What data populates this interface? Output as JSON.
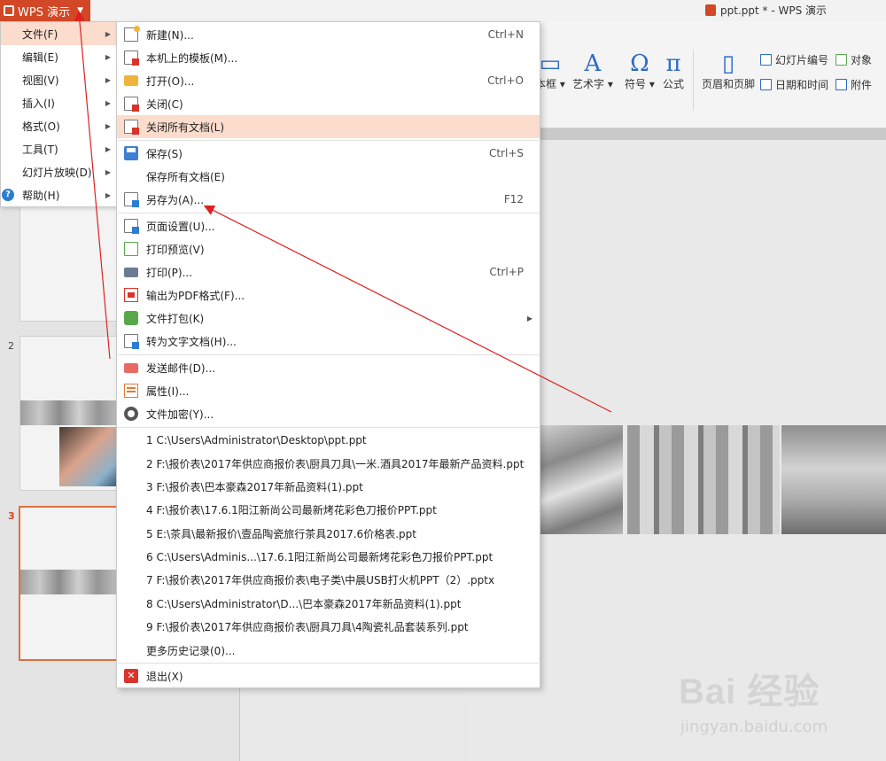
{
  "app": {
    "name": "WPS 演示",
    "window_title": "ppt.ppt * - WPS 演示"
  },
  "ribbon": {
    "items": [
      {
        "label": "本框 ▾"
      },
      {
        "label": "艺术字 ▾",
        "glyph": "A"
      },
      {
        "label": "符号 ▾",
        "glyph": "Ω"
      },
      {
        "label": "公式",
        "glyph": "π"
      },
      {
        "label": "页眉和页脚"
      },
      {
        "label": "幻灯片编号"
      },
      {
        "label": "对象"
      },
      {
        "label": "日期和时间"
      },
      {
        "label": "附件"
      }
    ]
  },
  "main_menu": {
    "items": [
      {
        "label": "文件(F)"
      },
      {
        "label": "编辑(E)"
      },
      {
        "label": "视图(V)"
      },
      {
        "label": "插入(I)"
      },
      {
        "label": "格式(O)"
      },
      {
        "label": "工具(T)"
      },
      {
        "label": "幻灯片放映(D)"
      },
      {
        "label": "帮助(H)"
      }
    ]
  },
  "file_menu": {
    "items": [
      {
        "label": "新建(N)...",
        "shortcut": "Ctrl+N"
      },
      {
        "label": "本机上的模板(M)..."
      },
      {
        "label": "打开(O)...",
        "shortcut": "Ctrl+O"
      },
      {
        "label": "关闭(C)"
      },
      {
        "label": "关闭所有文档(L)"
      },
      {
        "label": "保存(S)",
        "shortcut": "Ctrl+S"
      },
      {
        "label": "保存所有文档(E)"
      },
      {
        "label": "另存为(A)...",
        "shortcut": "F12"
      },
      {
        "label": "页面设置(U)..."
      },
      {
        "label": "打印预览(V)"
      },
      {
        "label": "打印(P)...",
        "shortcut": "Ctrl+P"
      },
      {
        "label": "输出为PDF格式(F)..."
      },
      {
        "label": "文件打包(K)"
      },
      {
        "label": "转为文字文档(H)..."
      },
      {
        "label": "发送邮件(D)..."
      },
      {
        "label": "属性(I)..."
      },
      {
        "label": "文件加密(Y)..."
      }
    ],
    "recent": [
      "1 C:\\Users\\Administrator\\Desktop\\ppt.ppt",
      "2 F:\\报价表\\2017年供应商报价表\\厨具刀具\\一米.酒具2017年最新产品资料.ppt",
      "3 F:\\报价表\\巴本豪森2017年新品资料(1).ppt",
      "4 F:\\报价表\\17.6.1阳江新尚公司最新烤花彩色刀报价PPT.ppt",
      "5 E:\\茶具\\最新报价\\壹品陶瓷旅行茶具2017.6价格表.ppt",
      "6 C:\\Users\\Adminis...\\17.6.1阳江新尚公司最新烤花彩色刀报价PPT.ppt",
      "7 F:\\报价表\\2017年供应商报价表\\电子类\\中晨USB打火机PPT（2）.pptx",
      "8 C:\\Users\\Administrator\\D...\\巴本豪森2017年新品资料(1).ppt",
      "9 F:\\报价表\\2017年供应商报价表\\厨具刀具\\4陶瓷礼品套装系列.ppt"
    ],
    "more_history": "更多历史记录(0)...",
    "exit": "退出(X)"
  },
  "slides": {
    "numbers": [
      "2",
      "3"
    ]
  },
  "watermark": {
    "text": "Bai 经验",
    "sub": "jingyan.baidu.com"
  },
  "colors": {
    "accent": "#d24726",
    "highlight": "#fbdccd",
    "annotation": "#e02020"
  }
}
